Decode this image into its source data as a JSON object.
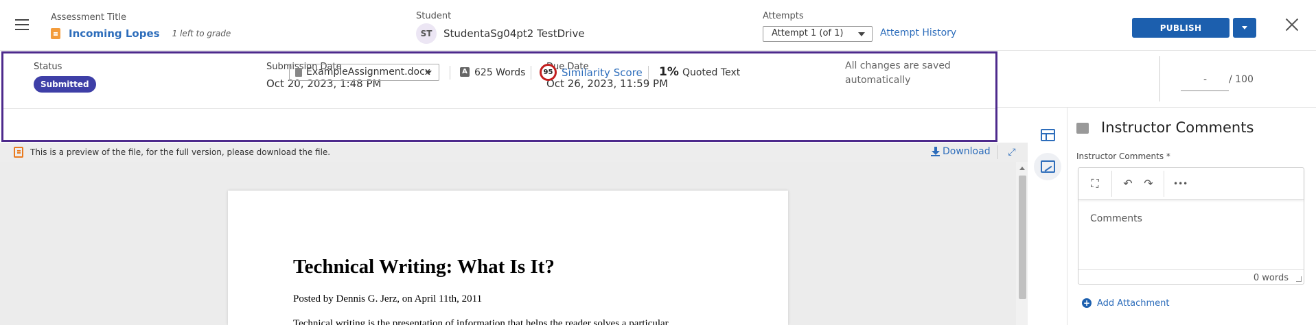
{
  "header": {
    "assessment_label": "Assessment Title",
    "assessment_title": "Incoming Lopes",
    "left_to_grade": "1 left to grade",
    "student_label": "Student",
    "student_initials": "ST",
    "student_name": "StudentaSg04pt2 TestDrive",
    "attempts_label": "Attempts",
    "attempt_selected": "Attempt 1 (of 1)",
    "attempt_history": "Attempt History",
    "publish_label": "PUBLISH"
  },
  "info": {
    "status_label": "Status",
    "status_value": "Submitted",
    "submission_label": "Submission Date",
    "submission_value": "Oct 20, 2023, 1:48 PM",
    "due_label": "Due Date",
    "due_value": "Oct 26, 2023, 11:59 PM",
    "saved_text": "All changes are saved automatically",
    "file_selected": "ExampleAssignment.docx",
    "words_icon": "A",
    "words": "625 Words",
    "similarity_value": "95",
    "similarity_label": "Similarity Score",
    "quoted_pct": "1%",
    "quoted_label": "Quoted Text"
  },
  "score": {
    "value": "-",
    "max": "/ 100"
  },
  "preview": {
    "notice": "This is a preview of the file, for the full version, please download the file.",
    "download_label": "Download"
  },
  "document": {
    "title": "Technical Writing: What Is It?",
    "meta": "Posted by Dennis G. Jerz, on April 11th, 2011",
    "body_first_line": "Technical writing is the presentation of information that helps the reader solves a particular"
  },
  "comments": {
    "title": "Instructor Comments",
    "field_label": "Instructor Comments *",
    "placeholder": "Comments",
    "word_count": "0 words",
    "add_attachment": "Add Attachment",
    "toolbar": {
      "expand": "⛶",
      "undo": "↶",
      "redo": "↷",
      "more": "•••"
    }
  },
  "colors": {
    "accent": "#1c5fae",
    "link": "#2d6dbb",
    "status_pill": "#3e3fa7",
    "highlight_border": "#4d2a8c",
    "similarity_ring": "#c21d1d"
  }
}
